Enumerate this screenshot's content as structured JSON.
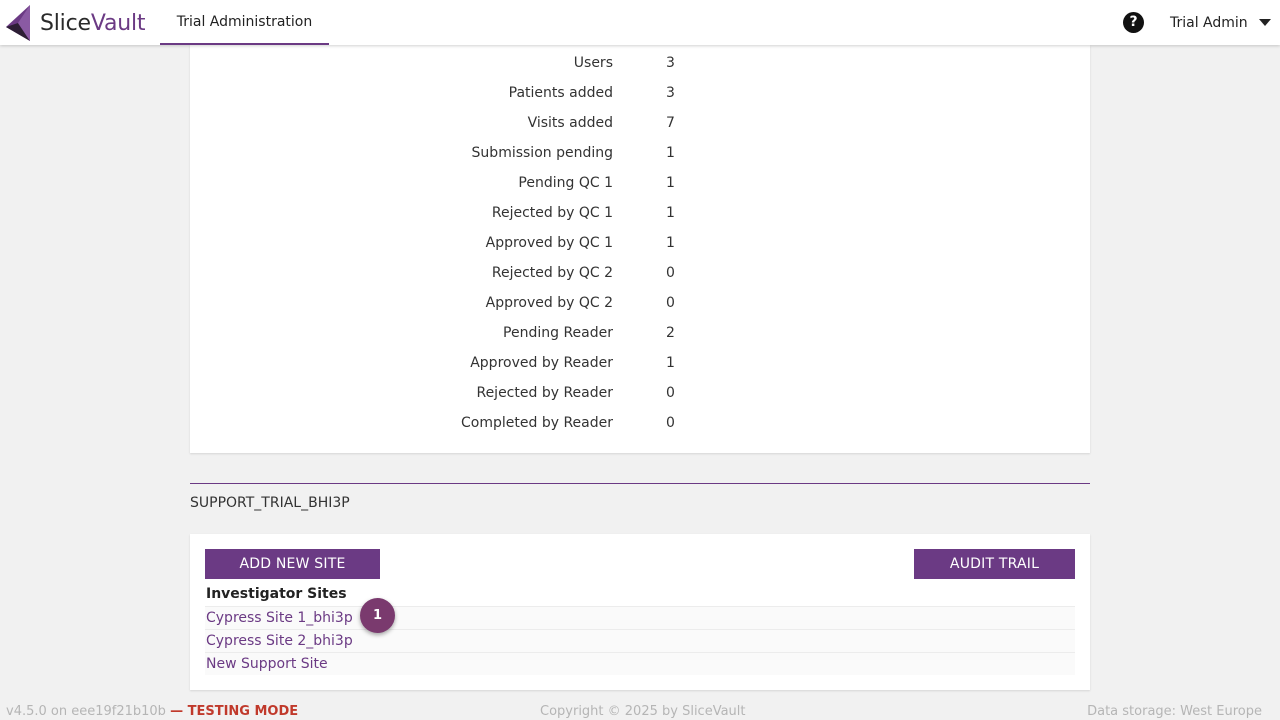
{
  "app": {
    "name_part1": "Slice",
    "name_part2": "Vault"
  },
  "nav": {
    "active_tab": "Trial Administration"
  },
  "header": {
    "help_icon": "?",
    "user_name": "Trial Admin"
  },
  "stats": [
    {
      "label": "Users",
      "value": "3"
    },
    {
      "label": "Patients added",
      "value": "3"
    },
    {
      "label": "Visits added",
      "value": "7"
    },
    {
      "label": "Submission pending",
      "value": "1"
    },
    {
      "label": "Pending QC 1",
      "value": "1"
    },
    {
      "label": "Rejected by QC 1",
      "value": "1"
    },
    {
      "label": "Approved by QC 1",
      "value": "1"
    },
    {
      "label": "Rejected by QC 2",
      "value": "0"
    },
    {
      "label": "Approved by QC 2",
      "value": "0"
    },
    {
      "label": "Pending Reader",
      "value": "2"
    },
    {
      "label": "Approved by Reader",
      "value": "1"
    },
    {
      "label": "Rejected by Reader",
      "value": "0"
    },
    {
      "label": "Completed by Reader",
      "value": "0"
    }
  ],
  "trial": {
    "name": "SUPPORT_TRIAL_BHI3P",
    "add_site_label": "ADD NEW SITE",
    "audit_trail_label": "AUDIT TRAIL",
    "sites_heading": "Investigator Sites",
    "sites": [
      "Cypress Site 1_bhi3p",
      "Cypress Site 2_bhi3p",
      "New Support Site"
    ]
  },
  "tour_badge": "1",
  "footer": {
    "version": "v4.5.0 on eee19f21b10b",
    "mode": "— TESTING MODE",
    "copyright": "Copyright © 2025 by SliceVault",
    "storage": "Data storage: West Europe"
  },
  "colors": {
    "brand": "#6b3a84",
    "badge": "#7a3a6e",
    "testing_mode": "#c0392b"
  }
}
